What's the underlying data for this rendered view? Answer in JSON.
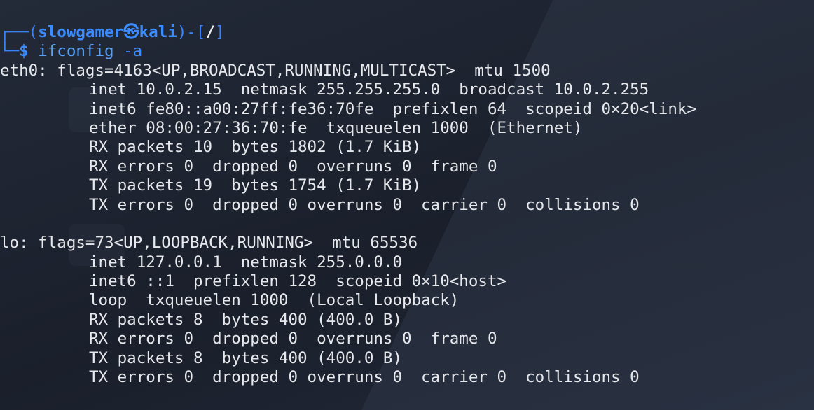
{
  "prompt": {
    "box_top": "┌──(",
    "user": "slowgamer",
    "at_icon": "㉿",
    "host": "kali",
    "bracket_mid": ")-[",
    "path": "/",
    "bracket_close": "]",
    "box_bottom": "└─",
    "dollar": "$",
    "command": "ifconfig",
    "arg": "-a"
  },
  "output": {
    "eth0": {
      "header": "eth0: flags=4163<UP,BROADCAST,RUNNING,MULTICAST>  mtu 1500",
      "lines": [
        "inet 10.0.2.15  netmask 255.255.255.0  broadcast 10.0.2.255",
        "inet6 fe80::a00:27ff:fe36:70fe  prefixlen 64  scopeid 0×20<link>",
        "ether 08:00:27:36:70:fe  txqueuelen 1000  (Ethernet)",
        "RX packets 10  bytes 1802 (1.7 KiB)",
        "RX errors 0  dropped 0  overruns 0  frame 0",
        "TX packets 19  bytes 1754 (1.7 KiB)",
        "TX errors 0  dropped 0 overruns 0  carrier 0  collisions 0"
      ]
    },
    "lo": {
      "header": "lo: flags=73<UP,LOOPBACK,RUNNING>  mtu 65536",
      "lines": [
        "inet 127.0.0.1  netmask 255.0.0.0",
        "inet6 ::1  prefixlen 128  scopeid 0×10<host>",
        "loop  txqueuelen 1000  (Local Loopback)",
        "RX packets 8  bytes 400 (400.0 B)",
        "RX errors 0  dropped 0  overruns 0  frame 0",
        "TX packets 8  bytes 400 (400.0 B)",
        "TX errors 0  dropped 0 overruns 0  carrier 0  collisions 0"
      ]
    }
  },
  "colors": {
    "background": "#1c2230",
    "prompt_accent": "#3b8cff",
    "text": "#e6e8ec"
  }
}
